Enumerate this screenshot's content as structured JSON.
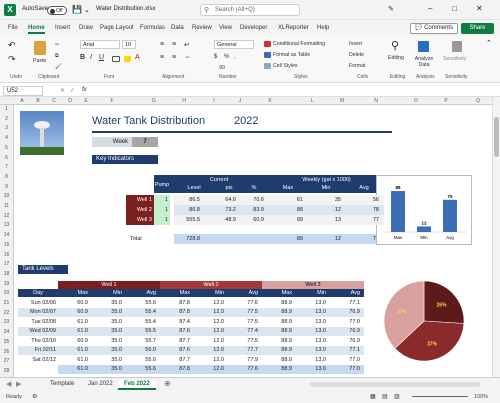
{
  "titlebar": {
    "autosave": "AutoSave",
    "autosave_state": "Off",
    "filename": "Water Distribution.xlsx",
    "search_placeholder": "Search (Alt+Q)"
  },
  "menu": {
    "items": [
      "File",
      "Home",
      "Insert",
      "Draw",
      "Page Layout",
      "Formulas",
      "Data",
      "Review",
      "View",
      "Developer",
      "XLReporter",
      "Help"
    ],
    "active": "Home",
    "comments": "Comments",
    "share": "Share"
  },
  "ribbon": {
    "groups": [
      "Undo",
      "Clipboard",
      "Font",
      "Alignment",
      "Number",
      "Styles",
      "Cells",
      "Editing",
      "Analysis",
      "Sensitivity"
    ],
    "paste": "Paste",
    "font_name": "Arial",
    "font_size": "10",
    "number_format": "General",
    "cond_format": "Conditional Formatting",
    "format_table": "Format as Table",
    "cell_styles": "Cell Styles",
    "insert": "Insert",
    "delete": "Delete",
    "format": "Format",
    "editing": "Editing",
    "analyze": "Analyze Data",
    "sensitivity": "Sensitivity"
  },
  "formula_bar": {
    "name_box": "U52",
    "fx": "fx",
    "value": ""
  },
  "columns": [
    "A",
    "B",
    "C",
    "D",
    "E",
    "F",
    "G",
    "H",
    "I",
    "J",
    "K",
    "L",
    "M",
    "N",
    "O",
    "P",
    "Q",
    "R"
  ],
  "rows": [
    "1",
    "2",
    "3",
    "4",
    "5",
    "6",
    "7",
    "8",
    "9",
    "10",
    "11",
    "12",
    "13",
    "14",
    "15",
    "16",
    "17",
    "18",
    "19",
    "20",
    "21",
    "22",
    "23",
    "24",
    "25",
    "26",
    "27",
    "28"
  ],
  "sheet": {
    "title": "Water Tank Distribution",
    "year": "2022",
    "week_label": "Week",
    "week_value": "7",
    "key_indicators": "Key Indicators",
    "current_header": "Current",
    "weekly_header": "Weekly (gal x 1000)",
    "col_pump": "Pump",
    "col_level": "Level",
    "col_psi": "psi",
    "col_pct": "%",
    "col_max": "Max",
    "col_min": "Min",
    "col_avg": "Avg",
    "wells": [
      {
        "name": "Well 1",
        "pump": "1",
        "level": "86.5",
        "psi": "64.6",
        "pct": "70.6",
        "max": "61",
        "min": "35",
        "avg": "56"
      },
      {
        "name": "Well 2",
        "pump": "1",
        "level": "86.8",
        "psi": "73.2",
        "pct": "83.9",
        "max": "88",
        "min": "12",
        "avg": "78"
      },
      {
        "name": "Well 3",
        "pump": "1",
        "level": "555.5",
        "psi": "48.9",
        "pct": "60.9",
        "max": "89",
        "min": "13",
        "avg": "77"
      }
    ],
    "total_label": "Total",
    "total": {
      "level": "728.8",
      "max": "89",
      "min": "12",
      "avg": "70"
    },
    "tank_levels": "Tank Levels",
    "day_label": "Day",
    "well1": "Well 1",
    "well2": "Well 2",
    "well3": "Well 3",
    "days": [
      {
        "day": "Sun 02/06",
        "w1": [
          "60.9",
          "35.0",
          "55.6"
        ],
        "w2": [
          "87.8",
          "12.0",
          "77.6"
        ],
        "w3": [
          "88.9",
          "13.0",
          "77.1"
        ]
      },
      {
        "day": "Mon 02/07",
        "w1": [
          "60.9",
          "35.0",
          "55.4"
        ],
        "w2": [
          "87.8",
          "12.0",
          "77.5"
        ],
        "w3": [
          "88.9",
          "13.0",
          "76.9"
        ]
      },
      {
        "day": "Tue 02/08",
        "w1": [
          "61.0",
          "35.0",
          "55.4"
        ],
        "w2": [
          "87.4",
          "12.0",
          "77.5"
        ],
        "w3": [
          "88.9",
          "13.0",
          "77.0"
        ]
      },
      {
        "day": "Wed 02/09",
        "w1": [
          "61.0",
          "35.0",
          "55.5"
        ],
        "w2": [
          "87.6",
          "12.0",
          "77.4"
        ],
        "w3": [
          "88.9",
          "13.0",
          "76.9"
        ]
      },
      {
        "day": "Thu 02/10",
        "w1": [
          "60.9",
          "35.0",
          "55.7"
        ],
        "w2": [
          "87.7",
          "12.0",
          "77.5"
        ],
        "w3": [
          "88.9",
          "13.0",
          "76.9"
        ]
      },
      {
        "day": "Fri 02/11",
        "w1": [
          "61.0",
          "35.0",
          "56.0"
        ],
        "w2": [
          "87.6",
          "12.0",
          "77.7"
        ],
        "w3": [
          "88.9",
          "13.0",
          "77.1"
        ]
      },
      {
        "day": "Sat 02/12",
        "w1": [
          "61.0",
          "35.0",
          "55.6"
        ],
        "w2": [
          "87.7",
          "12.0",
          "77.9"
        ],
        "w3": [
          "88.9",
          "13.0",
          "77.0"
        ]
      }
    ],
    "summary_row": {
      "w1": [
        "61.0",
        "35.0",
        "55.6"
      ],
      "w2": [
        "87.8",
        "12.0",
        "77.6"
      ],
      "w3": [
        "88.9",
        "13.0",
        "77.0"
      ]
    }
  },
  "tabs": [
    "Template",
    "Jan 2022",
    "Feb 2022"
  ],
  "active_tab": "Feb 2022",
  "status": {
    "ready": "Ready",
    "zoom": "100%"
  },
  "colors": {
    "navy": "#1f3c6e",
    "dark_red": "#7b2020",
    "rose": "#c98a8a",
    "chart_blue": "#3a6db5",
    "excel_green": "#107c41"
  },
  "chart_data": [
    {
      "type": "bar",
      "categories": [
        "Max",
        "Min",
        "Avg"
      ],
      "values": [
        89,
        12,
        70
      ],
      "data_labels": [
        "89",
        "12",
        "70"
      ]
    },
    {
      "type": "pie",
      "labels": [
        "26%",
        "37%",
        "37%"
      ],
      "values": [
        26,
        37,
        37
      ],
      "colors": [
        "#5c1a1a",
        "#8b2a2a",
        "#d9a0a0"
      ]
    }
  ]
}
